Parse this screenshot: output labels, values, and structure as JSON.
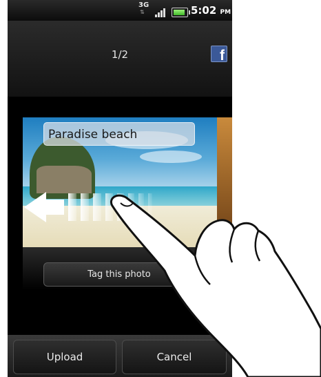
{
  "status_bar": {
    "network": "3G",
    "time": "5:02",
    "ampm": "PM",
    "icons": [
      "data-arrows-icon",
      "signal-icon",
      "battery-icon"
    ]
  },
  "header": {
    "counter": "1/2",
    "share_icon": "facebook-icon"
  },
  "photo": {
    "caption": "Paradise beach"
  },
  "actions": {
    "tag_label": "Tag this photo",
    "upload_label": "Upload",
    "cancel_label": "Cancel"
  },
  "gesture": {
    "icons": [
      "swipe-left-arrow-icon",
      "hand-pointer-icon"
    ]
  },
  "colors": {
    "facebook": "#3b5998",
    "battery": "#3fb82a"
  }
}
